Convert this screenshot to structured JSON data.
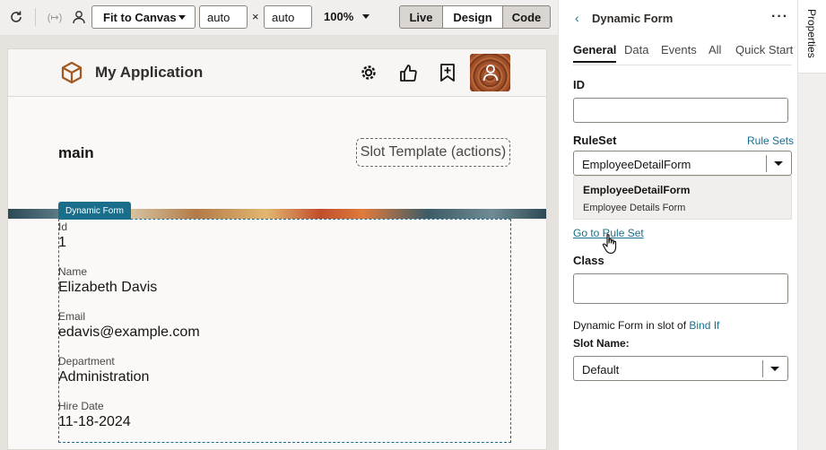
{
  "toolbar": {
    "fit_select": "Fit to Canvas",
    "width_value": "auto",
    "times": "×",
    "height_value": "auto",
    "zoom": "100%",
    "modes": [
      "Live",
      "Design",
      "Code"
    ],
    "active_mode": "Design"
  },
  "app": {
    "title": "My Application",
    "main_title": "main",
    "slot_template": "Slot Template (actions)"
  },
  "dynamic_form": {
    "badge": "Dynamic Form",
    "fields": [
      {
        "label": "Id",
        "value": "1"
      },
      {
        "label": "Name",
        "value": "Elizabeth Davis"
      },
      {
        "label": "Email",
        "value": "edavis@example.com"
      },
      {
        "label": "Department",
        "value": "Administration"
      },
      {
        "label": "Hire Date",
        "value": "11-18-2024"
      }
    ]
  },
  "panel": {
    "title": "Dynamic Form",
    "more": "···",
    "tabs": [
      "General",
      "Data",
      "Events",
      "All",
      "Quick Start"
    ],
    "id_label": "ID",
    "ruleset_label": "RuleSet",
    "rule_sets_link": "Rule Sets",
    "ruleset_value": "EmployeeDetailForm",
    "dropdown_title": "EmployeeDetailForm",
    "dropdown_subtitle": "Employee Details Form",
    "go_to_rule_set": "Go to Rule Set",
    "class_label": "Class",
    "slot_of_label": "Dynamic Form in slot of",
    "bind_if": "Bind If",
    "slot_name_label": "Slot Name:",
    "slot_name_value": "Default"
  },
  "side_tab": "Properties",
  "colors": {
    "accent": "#1b6e8b",
    "badge": "#1b6e8b"
  }
}
